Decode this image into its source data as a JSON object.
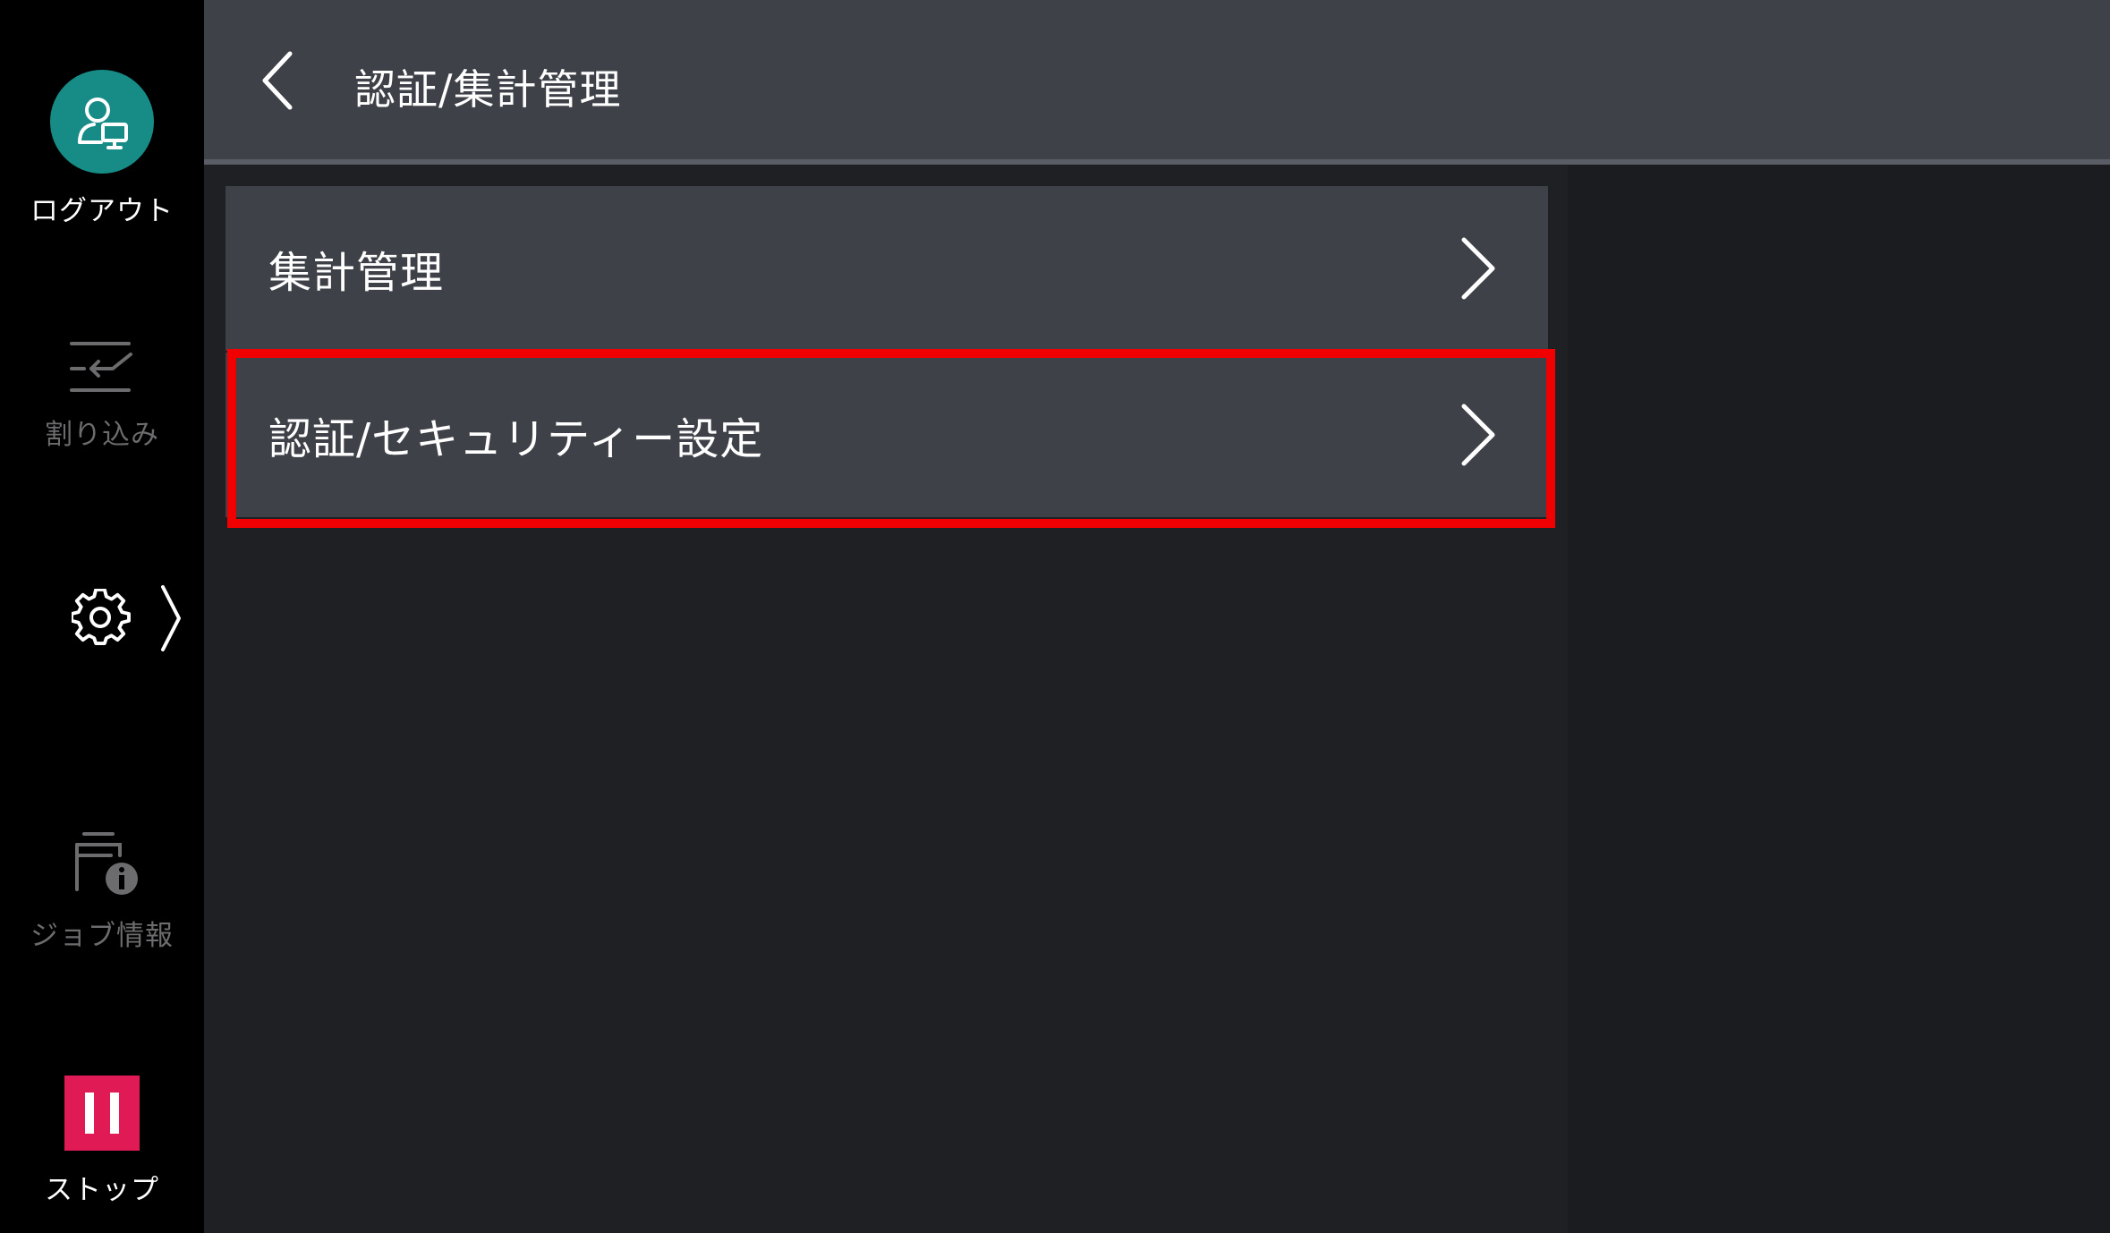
{
  "sidebar": {
    "logout_label": "ログアウト",
    "interrupt_label": "割り込み",
    "jobinfo_label": "ジョブ情報",
    "stop_label": "ストップ"
  },
  "header": {
    "title": "認証/集計管理"
  },
  "menu": {
    "items": [
      {
        "label": "集計管理"
      },
      {
        "label": "認証/セキュリティー設定"
      }
    ]
  },
  "icons": {
    "logout": "user-monitor-icon",
    "interrupt": "interrupt-icon",
    "settings": "gear-icon",
    "jobinfo": "job-info-icon",
    "stop": "pause-icon",
    "back": "chevron-left-icon",
    "chevron": "chevron-right-icon"
  },
  "colors": {
    "logout_circle": "#178c87",
    "stop_button": "#e01a55",
    "highlight": "#f00000",
    "header_bg": "#3f4148"
  }
}
